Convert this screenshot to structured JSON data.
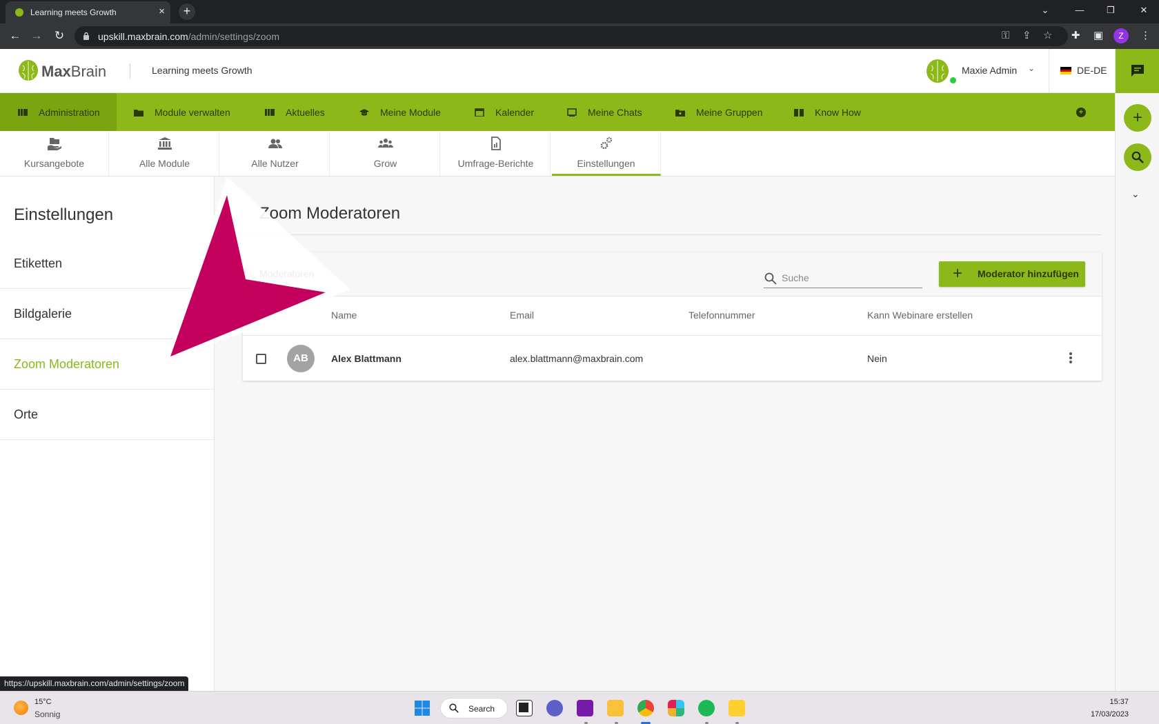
{
  "browser": {
    "tab_title": "Learning meets Growth",
    "tab_close": "×",
    "new_tab": "+",
    "url_domain": "upskill.maxbrain.com",
    "url_path": "/admin/settings/zoom",
    "profile_initial": "Z",
    "status_url": "https://upskill.maxbrain.com/admin/settings/zoom"
  },
  "header": {
    "logo_bold": "Max",
    "logo_light": "Brain",
    "slogan": "Learning meets Growth",
    "user_name": "Maxie Admin",
    "language": "DE-DE"
  },
  "main_nav": [
    {
      "label": "Administration",
      "icon": "admin-icon",
      "active": true
    },
    {
      "label": "Module verwalten",
      "icon": "folder-icon"
    },
    {
      "label": "Aktuelles",
      "icon": "news-icon"
    },
    {
      "label": "Meine Module",
      "icon": "graduation-cap-icon"
    },
    {
      "label": "Kalender",
      "icon": "calendar-icon"
    },
    {
      "label": "Meine Chats",
      "icon": "chat-icon"
    },
    {
      "label": "Meine Gruppen",
      "icon": "group-folder-icon"
    },
    {
      "label": "Know How",
      "icon": "book-icon"
    }
  ],
  "sub_nav": [
    {
      "label": "Kursangebote",
      "icon": "course-hand-icon"
    },
    {
      "label": "Alle Module",
      "icon": "institution-icon"
    },
    {
      "label": "Alle Nutzer",
      "icon": "users-icon"
    },
    {
      "label": "Grow",
      "icon": "group-icon"
    },
    {
      "label": "Umfrage-Berichte",
      "icon": "report-icon"
    },
    {
      "label": "Einstellungen",
      "icon": "gears-icon",
      "active": true
    }
  ],
  "sidebar": {
    "title": "Einstellungen",
    "items": [
      {
        "label": "Etiketten"
      },
      {
        "label": "Bildgalerie"
      },
      {
        "label": "Zoom Moderatoren",
        "active": true
      },
      {
        "label": "Orte"
      }
    ]
  },
  "content": {
    "title": "Zoom Moderatoren",
    "card_title": "Moderatoren",
    "search_placeholder": "Suche",
    "add_button_label": "Moderator hinzufügen",
    "columns": [
      "Name",
      "Email",
      "Telefonnummer",
      "Kann Webinare erstellen"
    ],
    "rows": [
      {
        "initials": "AB",
        "name": "Alex Blattmann",
        "email": "alex.blattmann@maxbrain.com",
        "phone": "",
        "can_create": "Nein"
      }
    ]
  },
  "taskbar": {
    "temperature": "15°C",
    "condition": "Sonnig",
    "search_label": "Search",
    "time": "15:37",
    "date": "17/03/2023"
  },
  "colors": {
    "brand_green": "#8cb81a",
    "pointer_magenta": "#c4005f"
  }
}
